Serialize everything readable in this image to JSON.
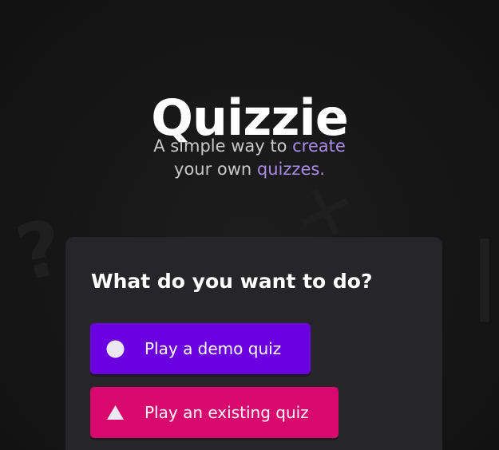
{
  "app": {
    "title": "Quizzie",
    "subtitle": {
      "part1": "A simple way to ",
      "accent1": "create",
      "part2": "your own ",
      "accent2": "quizzes."
    }
  },
  "card": {
    "title": "What do you want to do?",
    "buttons": [
      {
        "label": "Play a demo quiz",
        "icon": "circle-icon",
        "color": "#6b00e0"
      },
      {
        "label": "Play an existing quiz",
        "icon": "triangle-icon",
        "color": "#d9086e"
      }
    ]
  },
  "background": {
    "glyphs": [
      "?",
      "✕",
      "|"
    ]
  },
  "colors": {
    "accent": "#a98ae6",
    "card_bg": "#262628",
    "page_bg": "#141414"
  }
}
